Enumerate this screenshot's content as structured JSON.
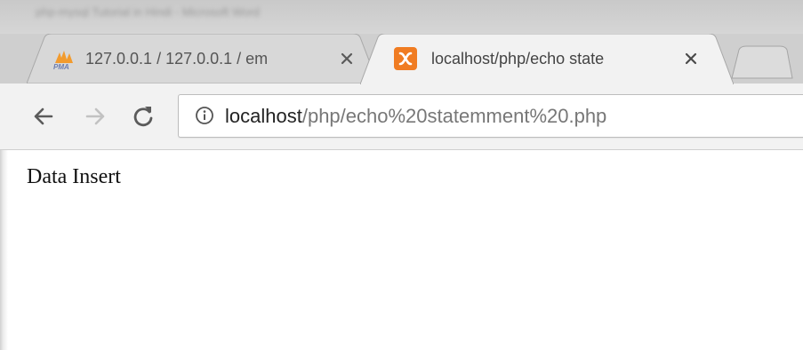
{
  "window": {
    "title_blurred": "php-mysql Tutorial in Hindi - Microsoft Word"
  },
  "tabs": [
    {
      "title": "127.0.0.1 / 127.0.0.1 / em",
      "icon": "phpmyadmin-icon",
      "active": false
    },
    {
      "title": "localhost/php/echo state",
      "icon": "xampp-icon",
      "active": true
    }
  ],
  "toolbar": {
    "back_icon": "back-arrow-icon",
    "forward_icon": "forward-arrow-icon",
    "reload_icon": "reload-icon"
  },
  "address_bar": {
    "host": "localhost",
    "path": "/php/echo%20statemment%20.php"
  },
  "page": {
    "text": "Data Insert"
  },
  "colors": {
    "xampp_orange": "#f07c22",
    "tab_active_bg": "#f2f2f2",
    "tab_inactive_bg": "#d8d8d8"
  }
}
